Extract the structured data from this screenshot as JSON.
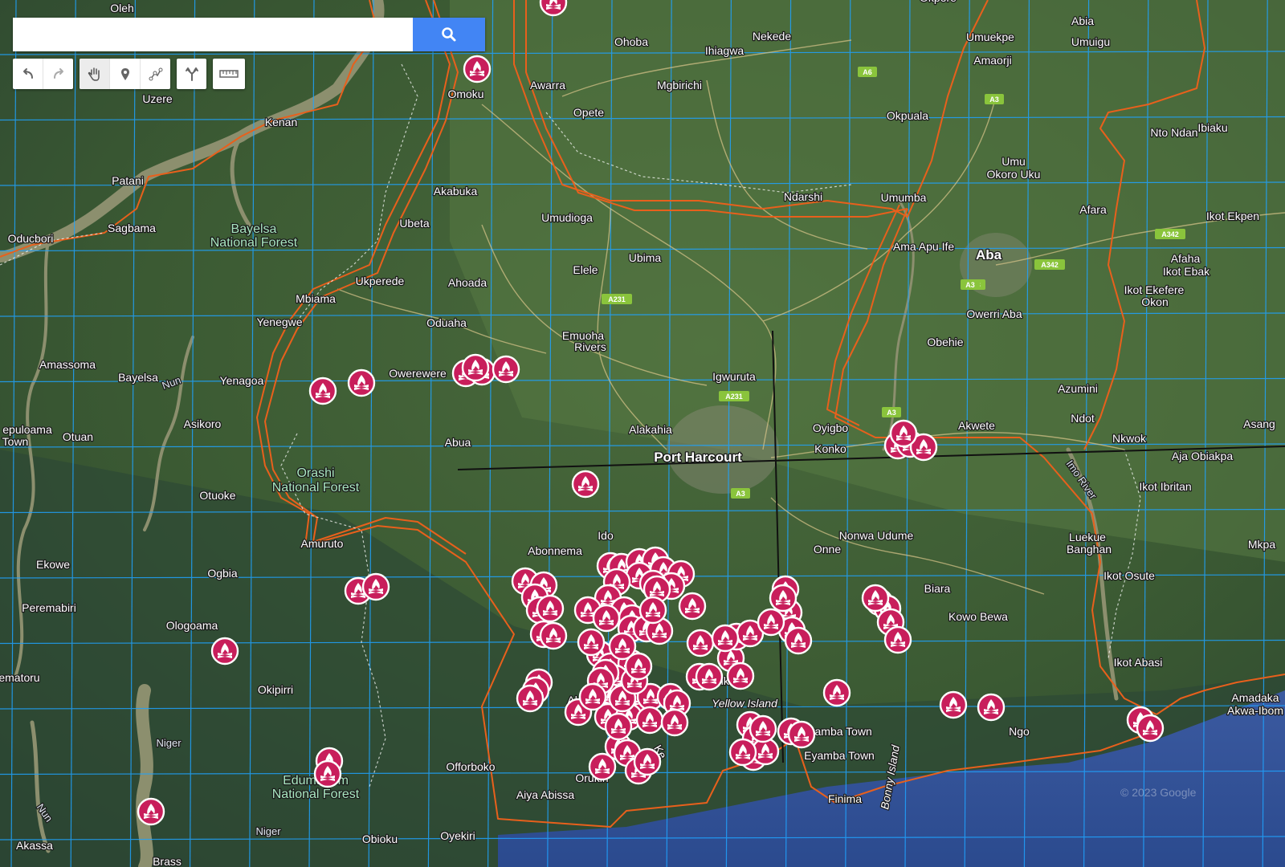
{
  "search": {
    "placeholder": "",
    "value": ""
  },
  "toolbar": {
    "groups": [
      [
        {
          "name": "undo",
          "icon": "undo-icon"
        },
        {
          "name": "redo",
          "icon": "redo-icon"
        }
      ],
      [
        {
          "name": "pan",
          "icon": "hand-icon",
          "active": true
        },
        {
          "name": "add-marker",
          "icon": "marker-icon"
        },
        {
          "name": "draw-line",
          "icon": "line-icon"
        }
      ],
      [
        {
          "name": "directions",
          "icon": "directions-icon"
        }
      ],
      [
        {
          "name": "measure",
          "icon": "ruler-icon"
        }
      ]
    ]
  },
  "colors": {
    "boundary": "#e8601c",
    "grid": "#1fa3ff",
    "marker": "#c81e5b",
    "search_button": "#4285f4",
    "crosshair": "#111111"
  },
  "places": [
    {
      "name": "Oleh",
      "kind": "town"
    },
    {
      "name": "Omoku",
      "kind": "town"
    },
    {
      "name": "Ohoba",
      "kind": "town"
    },
    {
      "name": "Nekede",
      "kind": "town"
    },
    {
      "name": "Ihiagwa",
      "kind": "town"
    },
    {
      "name": "Okpore",
      "kind": "town"
    },
    {
      "name": "Abia",
      "kind": "town"
    },
    {
      "name": "Umuekpe",
      "kind": "town"
    },
    {
      "name": "Umuigu",
      "kind": "town"
    },
    {
      "name": "Amaorji",
      "kind": "town"
    },
    {
      "name": "Uzere",
      "kind": "town"
    },
    {
      "name": "Awarra",
      "kind": "town"
    },
    {
      "name": "Mgbirichi",
      "kind": "town"
    },
    {
      "name": "Opete",
      "kind": "town"
    },
    {
      "name": "Kenan",
      "kind": "town"
    },
    {
      "name": "Okpuala",
      "kind": "town"
    },
    {
      "name": "Nto Ndan",
      "kind": "town"
    },
    {
      "name": "Ibiaku",
      "kind": "town"
    },
    {
      "name": "Umu",
      "kind": "town"
    },
    {
      "name": "Okoro Uku",
      "kind": "town"
    },
    {
      "name": "Patani",
      "kind": "town"
    },
    {
      "name": "Akabuka",
      "kind": "town"
    },
    {
      "name": "Ndarshi",
      "kind": "town"
    },
    {
      "name": "Umumba",
      "kind": "town"
    },
    {
      "name": "Oducbori",
      "kind": "town"
    },
    {
      "name": "Sagbama",
      "kind": "town"
    },
    {
      "name": "Ubeta",
      "kind": "town"
    },
    {
      "name": "Umudioga",
      "kind": "town"
    },
    {
      "name": "Afara",
      "kind": "town"
    },
    {
      "name": "Ikot Ekpen",
      "kind": "town"
    },
    {
      "name": "Bayelsa",
      "kind": "park"
    },
    {
      "name": "National Forest",
      "kind": "park"
    },
    {
      "name": "Ama Apu Ife",
      "kind": "town"
    },
    {
      "name": "Aba",
      "kind": "city"
    },
    {
      "name": "Ubima",
      "kind": "town"
    },
    {
      "name": "Afaha",
      "kind": "town"
    },
    {
      "name": "Ikot Ebak",
      "kind": "town"
    },
    {
      "name": "Elele",
      "kind": "town"
    },
    {
      "name": "Ukperede",
      "kind": "town"
    },
    {
      "name": "Ahoada",
      "kind": "town"
    },
    {
      "name": "Mbiama",
      "kind": "town"
    },
    {
      "name": "Ikot Ekefere",
      "kind": "town"
    },
    {
      "name": "Okon",
      "kind": "town"
    },
    {
      "name": "Owerri Aba",
      "kind": "town"
    },
    {
      "name": "Yenegwe",
      "kind": "town"
    },
    {
      "name": "Oduaha",
      "kind": "town"
    },
    {
      "name": "Emuoha",
      "kind": "town"
    },
    {
      "name": "Rivers",
      "kind": "town"
    },
    {
      "name": "Obehie",
      "kind": "town"
    },
    {
      "name": "Amassoma",
      "kind": "town"
    },
    {
      "name": "Bayelsa",
      "kind": "town"
    },
    {
      "name": "Nun",
      "kind": "river"
    },
    {
      "name": "Yenagoa",
      "kind": "town"
    },
    {
      "name": "Owerewere",
      "kind": "town"
    },
    {
      "name": "Igwuruta",
      "kind": "town"
    },
    {
      "name": "Azumini",
      "kind": "town"
    },
    {
      "name": "Ndot",
      "kind": "town"
    },
    {
      "name": "Asikoro",
      "kind": "town"
    },
    {
      "name": "Alakahia",
      "kind": "town"
    },
    {
      "name": "Oyigbo",
      "kind": "town"
    },
    {
      "name": "Akwete",
      "kind": "town"
    },
    {
      "name": "Asang",
      "kind": "town"
    },
    {
      "name": "epuloama",
      "kind": "town"
    },
    {
      "name": "Town",
      "kind": "town"
    },
    {
      "name": "Otuan",
      "kind": "town"
    },
    {
      "name": "Abua",
      "kind": "town"
    },
    {
      "name": "Konko",
      "kind": "town"
    },
    {
      "name": "Nkwok",
      "kind": "town"
    },
    {
      "name": "Port Harcourt",
      "kind": "city"
    },
    {
      "name": "Aja Obiakpa",
      "kind": "town"
    },
    {
      "name": "Orashi",
      "kind": "park"
    },
    {
      "name": "National Forest",
      "kind": "park"
    },
    {
      "name": "Imo River",
      "kind": "river"
    },
    {
      "name": "Ikot Ibritan",
      "kind": "town"
    },
    {
      "name": "Otuoke",
      "kind": "town"
    },
    {
      "name": "Ido",
      "kind": "town"
    },
    {
      "name": "Nonwa Udume",
      "kind": "town"
    },
    {
      "name": "Luekue",
      "kind": "town"
    },
    {
      "name": "Banghan",
      "kind": "town"
    },
    {
      "name": "Mkpa",
      "kind": "town"
    },
    {
      "name": "Amuruto",
      "kind": "town"
    },
    {
      "name": "Abonnema",
      "kind": "town"
    },
    {
      "name": "Onne",
      "kind": "town"
    },
    {
      "name": "Ekowe",
      "kind": "town"
    },
    {
      "name": "Ogbia",
      "kind": "town"
    },
    {
      "name": "Ikot Osute",
      "kind": "town"
    },
    {
      "name": "Biara",
      "kind": "town"
    },
    {
      "name": "Peremabiri",
      "kind": "town"
    },
    {
      "name": "Kowo Bewa",
      "kind": "town"
    },
    {
      "name": "Ologoama",
      "kind": "town"
    },
    {
      "name": "Ikot Abasi",
      "kind": "town"
    },
    {
      "name": "ematoru",
      "kind": "town"
    },
    {
      "name": "Okipirri",
      "kind": "town"
    },
    {
      "name": "Tumkiri",
      "kind": "town"
    },
    {
      "name": "Yellow Island",
      "kind": "island"
    },
    {
      "name": "Alala",
      "kind": "town"
    },
    {
      "name": "Obe",
      "kind": "town"
    },
    {
      "name": "Amadaka",
      "kind": "town"
    },
    {
      "name": "Akwa-Ibom",
      "kind": "town"
    },
    {
      "name": "Eyamba Town",
      "kind": "town"
    },
    {
      "name": "Ngo",
      "kind": "town"
    },
    {
      "name": "Ke",
      "kind": "town"
    },
    {
      "name": "Eyamba Town",
      "kind": "town"
    },
    {
      "name": "Niger",
      "kind": "river"
    },
    {
      "name": "Offorboko",
      "kind": "town"
    },
    {
      "name": "Orukiri",
      "kind": "town"
    },
    {
      "name": "Bonny Island",
      "kind": "island"
    },
    {
      "name": "Edumanom",
      "kind": "park"
    },
    {
      "name": "National Forest",
      "kind": "park"
    },
    {
      "name": "Nun",
      "kind": "river"
    },
    {
      "name": "Aiya Abissa",
      "kind": "town"
    },
    {
      "name": "Finima",
      "kind": "town"
    },
    {
      "name": "Akassa",
      "kind": "town"
    },
    {
      "name": "Niger",
      "kind": "river"
    },
    {
      "name": "Obioku",
      "kind": "town"
    },
    {
      "name": "Oyekiri",
      "kind": "town"
    },
    {
      "name": "Brass",
      "kind": "town"
    },
    {
      "name": "le",
      "kind": "town"
    },
    {
      "name": "al",
      "kind": "town"
    }
  ],
  "road_shields": [
    "A6",
    "A3",
    "A231",
    "A342",
    "A3",
    "A342",
    "A3",
    "A231",
    "A3",
    "A3"
  ],
  "copyright": "© 2023 Google",
  "markers": {
    "count": 111,
    "icon": "campfire-icon"
  }
}
